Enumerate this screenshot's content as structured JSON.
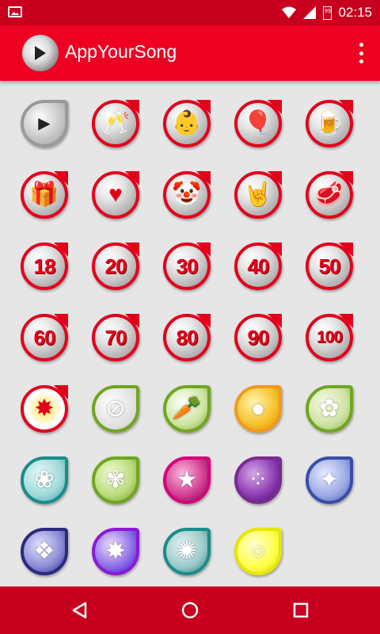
{
  "status_bar": {
    "time": "02:15",
    "battery_level": "99",
    "icons": [
      "image-notification-icon",
      "wifi-icon",
      "signal-icon",
      "battery-icon"
    ]
  },
  "app_bar": {
    "title": "AppYourSong",
    "icons": [
      "app-logo-icon",
      "overflow-menu-icon"
    ]
  },
  "grid": {
    "items": [
      {
        "name": "play-disc",
        "label": "",
        "style": "plain"
      },
      {
        "name": "champagne-glasses",
        "label": "",
        "style": "red"
      },
      {
        "name": "baby",
        "label": "",
        "style": "red"
      },
      {
        "name": "balloons",
        "label": "",
        "style": "red"
      },
      {
        "name": "beer-mug",
        "label": "",
        "style": "red"
      },
      {
        "name": "gift",
        "label": "",
        "style": "red"
      },
      {
        "name": "heart",
        "label": "",
        "style": "red"
      },
      {
        "name": "clown",
        "label": "",
        "style": "red"
      },
      {
        "name": "rock-hand",
        "label": "",
        "style": "red"
      },
      {
        "name": "steak",
        "label": "",
        "style": "red"
      },
      {
        "name": "age-18",
        "label": "18",
        "style": "red"
      },
      {
        "name": "age-20",
        "label": "20",
        "style": "red"
      },
      {
        "name": "age-30",
        "label": "30",
        "style": "red"
      },
      {
        "name": "age-40",
        "label": "40",
        "style": "red"
      },
      {
        "name": "age-50",
        "label": "50",
        "style": "red"
      },
      {
        "name": "age-60",
        "label": "60",
        "style": "red"
      },
      {
        "name": "age-70",
        "label": "70",
        "style": "red"
      },
      {
        "name": "age-80",
        "label": "80",
        "style": "red"
      },
      {
        "name": "age-90",
        "label": "90",
        "style": "red"
      },
      {
        "name": "age-100",
        "label": "100",
        "style": "red"
      },
      {
        "name": "yellow-splash",
        "label": "",
        "style": "red"
      },
      {
        "name": "no-meat",
        "label": "",
        "style": "green"
      },
      {
        "name": "vegetables",
        "label": "",
        "style": "green"
      },
      {
        "name": "barbecue",
        "label": "",
        "style": "orange"
      },
      {
        "name": "roses",
        "label": "",
        "style": "green"
      },
      {
        "name": "pink-flower",
        "label": "",
        "style": "teal"
      },
      {
        "name": "daisies",
        "label": "",
        "style": "green"
      },
      {
        "name": "stars",
        "label": "",
        "style": "pink"
      },
      {
        "name": "dots",
        "label": "",
        "style": "purple"
      },
      {
        "name": "crystal",
        "label": "",
        "style": "blue"
      },
      {
        "name": "diamonds",
        "label": "",
        "style": "navy"
      },
      {
        "name": "purple-splash",
        "label": "",
        "style": "violet"
      },
      {
        "name": "ink-splash",
        "label": "",
        "style": "teal"
      },
      {
        "name": "yellow-bubbles",
        "label": "",
        "style": "yellow"
      }
    ]
  },
  "nav_bar": {
    "icons": [
      "back-icon",
      "home-icon",
      "recents-icon"
    ]
  },
  "colors": {
    "status_bar": "#c8001e",
    "app_bar": "#ee0022",
    "accent_red": "#e3001b",
    "background": "#e6e6e6"
  }
}
